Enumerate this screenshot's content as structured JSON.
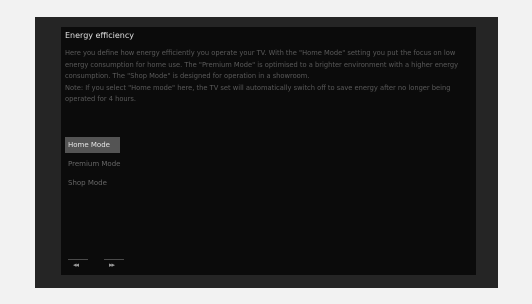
{
  "dialog": {
    "title": "Energy efficiency",
    "description": [
      "Here you define how energy efficiently you operate your TV. With the \"Home Mode\" setting you put the focus on low energy consumption for home use. The \"Premium Mode\" is optimised to a brighter environment with a higher energy consumption. The \"Shop Mode\" is designed for operation in a showroom.",
      "Note: If you select \"Home mode\" here, the TV set will automatically switch off to save energy after no longer being operated for 4 hours."
    ]
  },
  "menu": {
    "items": [
      {
        "label": "Home Mode",
        "selected": true
      },
      {
        "label": "Premium Mode",
        "selected": false
      },
      {
        "label": "Shop Mode",
        "selected": false
      }
    ]
  },
  "navigation": {
    "prev_icon": "double-chevron-left-icon",
    "next_icon": "double-chevron-right-icon",
    "prev_glyph": "◂◂",
    "next_glyph": "▸▸"
  },
  "colors": {
    "page_background": "#f2f2f2",
    "frame_background": "#252525",
    "dialog_background": "#0b0b0b",
    "selected_item": "#545454",
    "title_text": "#e0e0e0",
    "body_text": "#5a5a5a"
  }
}
